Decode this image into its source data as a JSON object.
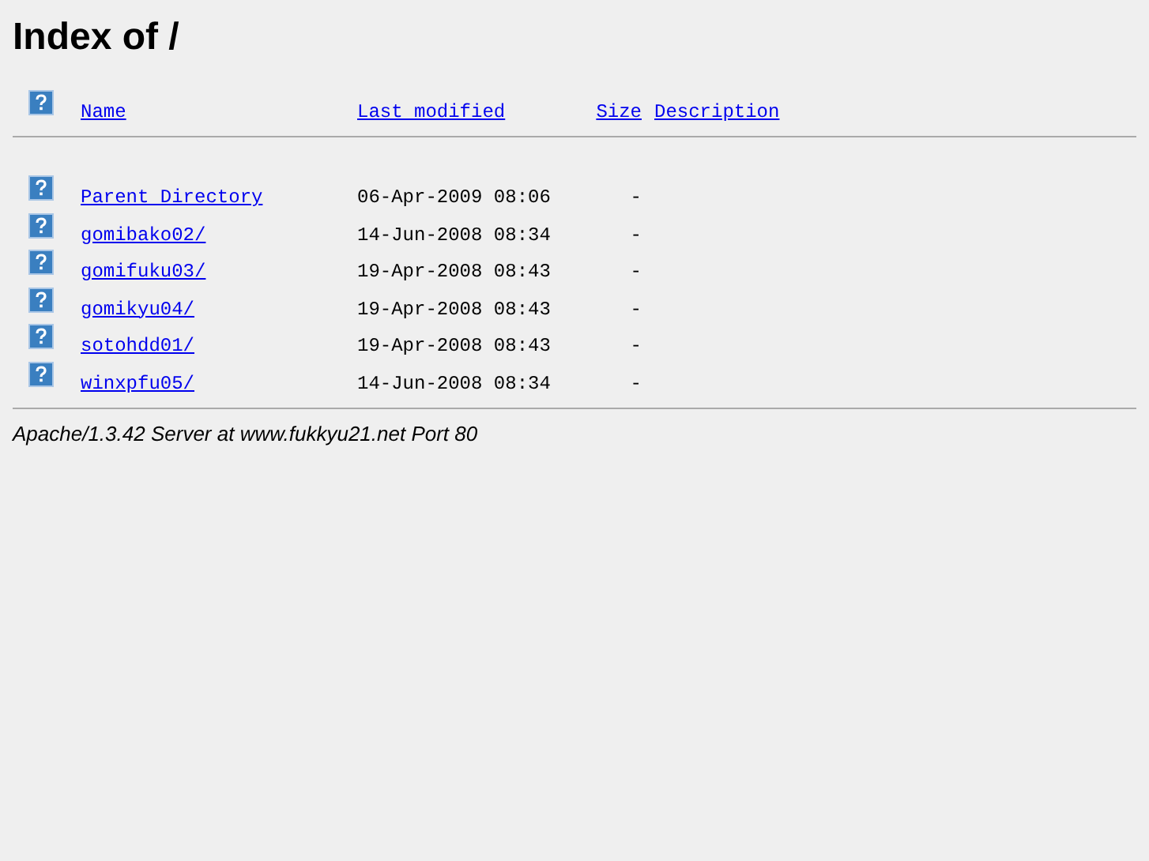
{
  "title": "Index of /",
  "columns": [
    {
      "label": "Name"
    },
    {
      "label": "Last modified"
    },
    {
      "label": "Size"
    },
    {
      "label": "Description"
    }
  ],
  "rows": [
    {
      "name": "Parent Directory",
      "modified": "06-Apr-2009 08:06",
      "size": "-"
    },
    {
      "name": "gomibako02/",
      "modified": "14-Jun-2008 08:34",
      "size": "-"
    },
    {
      "name": "gomifuku03/",
      "modified": "19-Apr-2008 08:43",
      "size": "-"
    },
    {
      "name": "gomikyu04/",
      "modified": "19-Apr-2008 08:43",
      "size": "-"
    },
    {
      "name": "sotohdd01/",
      "modified": "19-Apr-2008 08:43",
      "size": "-"
    },
    {
      "name": "winxpfu05/",
      "modified": "14-Jun-2008 08:34",
      "size": "-"
    }
  ],
  "footer": "Apache/1.3.42 Server at www.fukkyu21.net Port 80"
}
